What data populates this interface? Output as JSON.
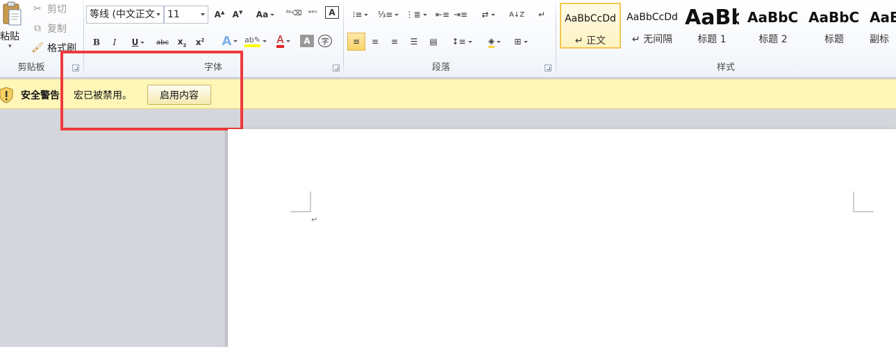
{
  "clipboard": {
    "paste_label": "粘贴",
    "cut_label": "剪切",
    "copy_label": "复制",
    "format_painter_label": "格式刷",
    "group_label": "剪贴板"
  },
  "font": {
    "font_name": "等线 (中文正文",
    "font_size": "11",
    "group_label": "字体"
  },
  "paragraph": {
    "group_label": "段落"
  },
  "styles": {
    "group_label": "样式",
    "items": [
      {
        "sample": "AaBbCcDd",
        "name": "↵ 正文"
      },
      {
        "sample": "AaBbCcDd",
        "name": "↵ 无间隔"
      },
      {
        "sample": "AaBb",
        "name": "标题 1"
      },
      {
        "sample": "AaBbC",
        "name": "标题 2"
      },
      {
        "sample": "AaBbC",
        "name": "标题"
      },
      {
        "sample": "AaB",
        "name": "副标"
      }
    ]
  },
  "security_bar": {
    "title": "安全警告",
    "message": "宏已被禁用。",
    "enable_button": "启用内容"
  },
  "document": {
    "paragraph_mark": "↵"
  },
  "colors": {
    "highlight_box": "#f0393b",
    "security_bar_bg": "#fff6b8",
    "selected_style": "#f2c54d",
    "font_color_red": "#e02020",
    "highlighter_yellow": "#ffff00"
  }
}
